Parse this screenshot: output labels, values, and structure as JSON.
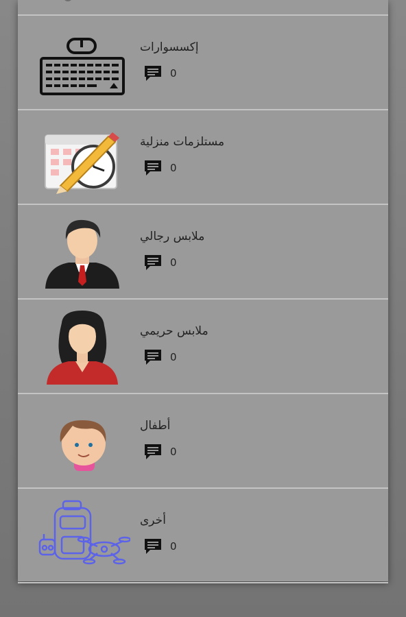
{
  "categories": [
    {
      "title": "إكسسوارات",
      "comments": "0",
      "icon": "keyboard-mouse-icon"
    },
    {
      "title": "مستلزمات منزلية",
      "comments": "0",
      "icon": "calendar-clock-pencil-icon"
    },
    {
      "title": "ملابس رجالي",
      "comments": "0",
      "icon": "man-avatar-icon"
    },
    {
      "title": "ملابس حريمي",
      "comments": "0",
      "icon": "woman-avatar-icon"
    },
    {
      "title": "أطفال",
      "comments": "0",
      "icon": "child-face-icon"
    },
    {
      "title": "أخرى",
      "comments": "0",
      "icon": "backpack-drone-icon"
    }
  ]
}
